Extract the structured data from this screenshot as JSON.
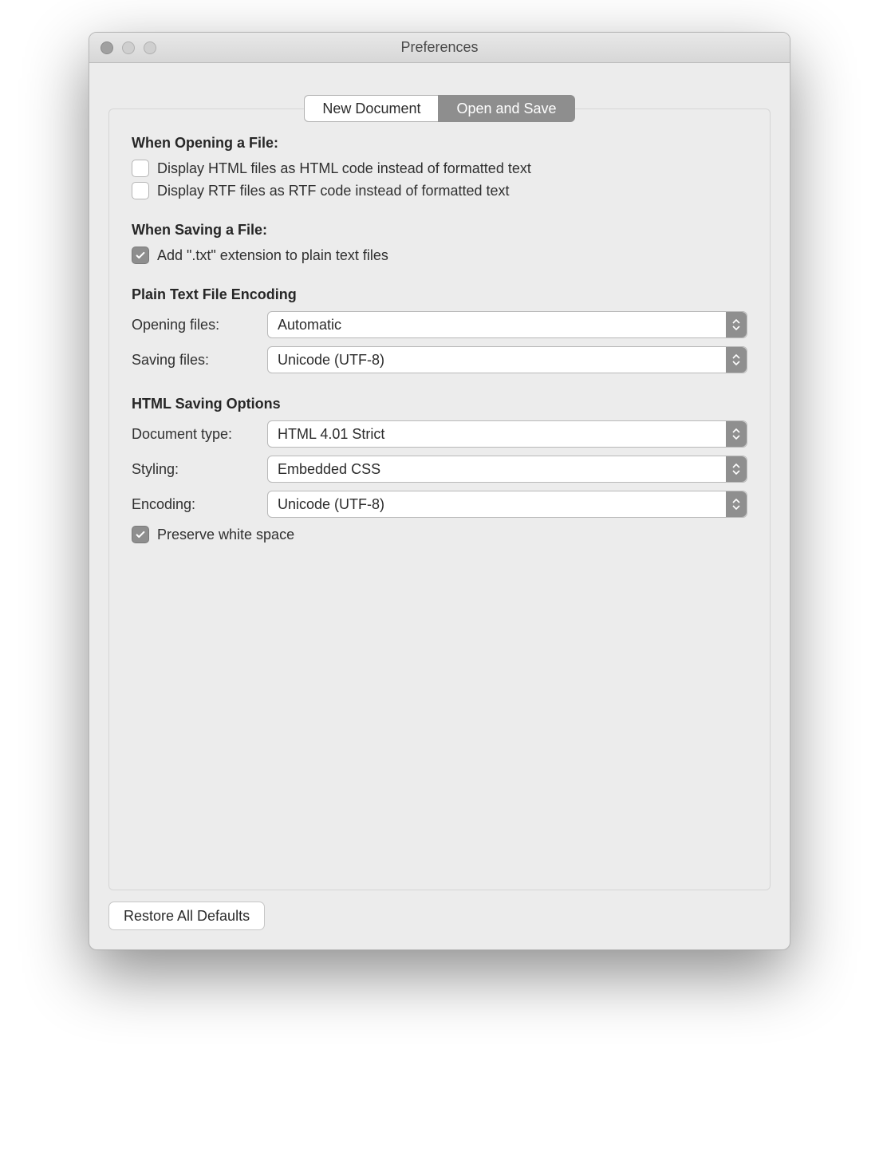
{
  "window": {
    "title": "Preferences"
  },
  "tabs": {
    "new_document": "New Document",
    "open_and_save": "Open and Save"
  },
  "sections": {
    "opening": {
      "title": "When Opening a File:",
      "html_checkbox_label": "Display HTML files as HTML code instead of formatted text",
      "rtf_checkbox_label": "Display RTF files as RTF code instead of formatted text"
    },
    "saving": {
      "title": "When Saving a File:",
      "txt_checkbox_label": "Add \".txt\" extension to plain text files"
    },
    "encoding": {
      "title": "Plain Text File Encoding",
      "opening_label": "Opening files:",
      "opening_value": "Automatic",
      "saving_label": "Saving files:",
      "saving_value": "Unicode (UTF-8)"
    },
    "html": {
      "title": "HTML Saving Options",
      "doctype_label": "Document type:",
      "doctype_value": "HTML 4.01 Strict",
      "styling_label": "Styling:",
      "styling_value": "Embedded CSS",
      "encoding_label": "Encoding:",
      "encoding_value": "Unicode (UTF-8)",
      "preserve_label": "Preserve white space"
    }
  },
  "footer": {
    "restore_label": "Restore All Defaults"
  }
}
